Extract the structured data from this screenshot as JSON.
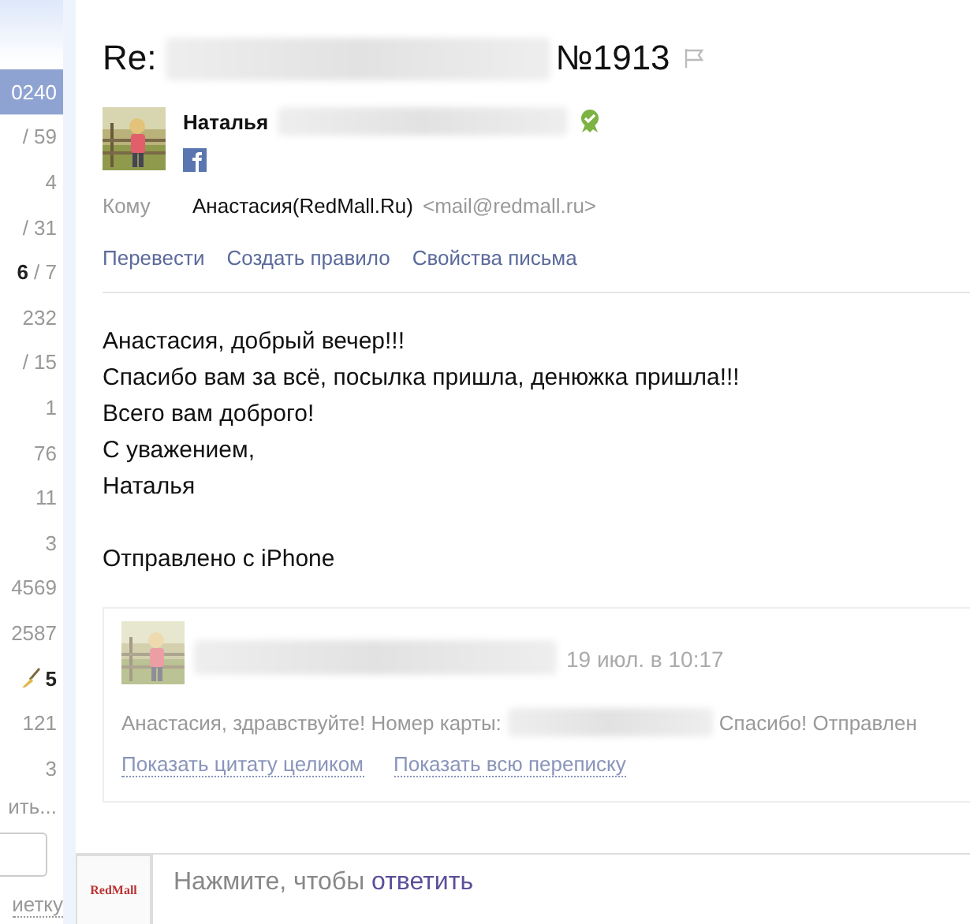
{
  "sidebar": {
    "items": [
      {
        "count": "0240",
        "selected": true,
        "kind": "count"
      },
      {
        "count": "/ 59",
        "selected": false,
        "kind": "count"
      },
      {
        "count": "4",
        "selected": false,
        "kind": "count"
      },
      {
        "count": "/ 31",
        "selected": false,
        "kind": "count"
      },
      {
        "count": "**6** / 7",
        "selected": false,
        "kind": "count"
      },
      {
        "count": "232",
        "selected": false,
        "kind": "count"
      },
      {
        "count": "/ 15",
        "selected": false,
        "kind": "count"
      },
      {
        "count": "1",
        "selected": false,
        "kind": "count"
      },
      {
        "count": "76",
        "selected": false,
        "kind": "count"
      },
      {
        "count": "11",
        "selected": false,
        "kind": "count"
      },
      {
        "count": "3",
        "selected": false,
        "kind": "count"
      },
      {
        "count": "4569",
        "selected": false,
        "kind": "count"
      },
      {
        "count": "2587",
        "selected": false,
        "kind": "count"
      },
      {
        "count": "5",
        "selected": false,
        "kind": "broom"
      },
      {
        "count": "121",
        "selected": false,
        "kind": "count"
      },
      {
        "count": "3",
        "selected": false,
        "kind": "count"
      },
      {
        "count": "ить...",
        "selected": false,
        "kind": "link"
      }
    ],
    "bottom_link": "иетку"
  },
  "message": {
    "subject_prefix": "Re:",
    "subject_suffix": "№1913",
    "sender": {
      "name": "Наталья"
    },
    "to_label": "Кому",
    "to_name": "Анастасия(RedMall.Ru)",
    "to_email": "<mail@redmall.ru>",
    "actions": [
      "Перевести",
      "Создать правило",
      "Свойства письма"
    ],
    "body": [
      [
        "Анастасия, добрый вечер!!!",
        "Спасибо вам за всё, посылка пришла, денюжка пришла!!!",
        "Всего вам доброго!",
        "С уважением,",
        "Наталья"
      ],
      [
        "Отправлено с iPhone"
      ]
    ],
    "quote": {
      "date": "19 июл. в 10:17",
      "text_before": "Анастасия, здравствуйте! Номер карты:",
      "text_after": "Спасибо! Отправлен",
      "links": [
        "Показать цитату целиком",
        "Показать всю переписку"
      ]
    }
  },
  "reply": {
    "logo": "RedMall",
    "prompt": "Нажмите, чтобы",
    "action": "ответить"
  }
}
